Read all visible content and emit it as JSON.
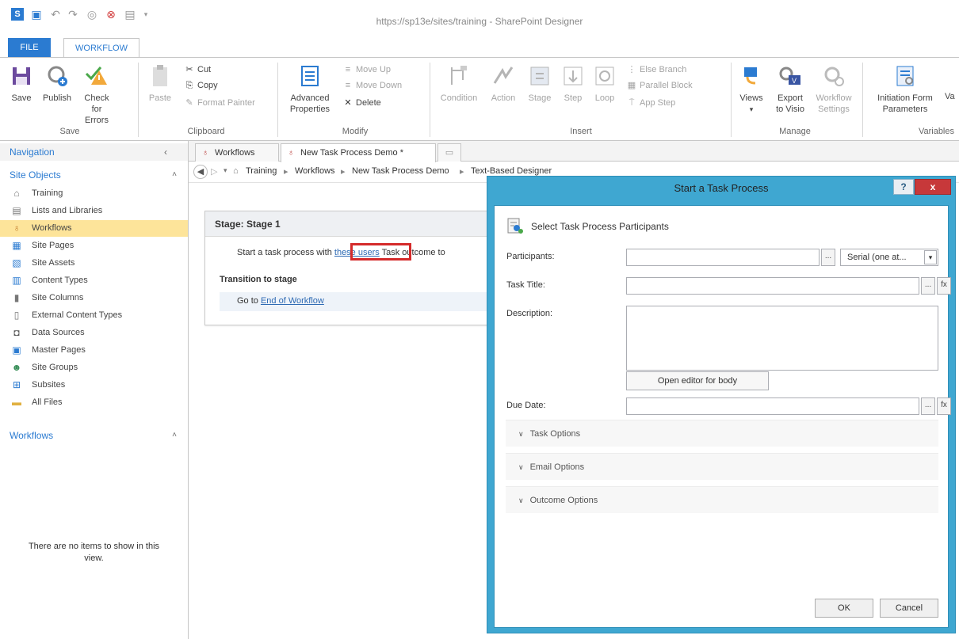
{
  "window": {
    "title": "https://sp13e/sites/training - SharePoint Designer"
  },
  "ribbon_tabs": {
    "file": "FILE",
    "workflow": "WORKFLOW"
  },
  "ribbon": {
    "save": "Save",
    "publish": "Publish",
    "check_errors_1": "Check",
    "check_errors_2": "for Errors",
    "group_save": "Save",
    "paste": "Paste",
    "cut": "Cut",
    "copy": "Copy",
    "format_painter": "Format Painter",
    "group_clipboard": "Clipboard",
    "advanced_properties_1": "Advanced",
    "advanced_properties_2": "Properties",
    "move_up": "Move Up",
    "move_down": "Move Down",
    "delete": "Delete",
    "group_modify": "Modify",
    "condition": "Condition",
    "action": "Action",
    "stage": "Stage",
    "step": "Step",
    "loop": "Loop",
    "else_branch": "Else Branch",
    "parallel_block": "Parallel Block",
    "app_step": "App Step",
    "group_insert": "Insert",
    "views": "Views",
    "export_visio_1": "Export",
    "export_visio_2": "to Visio",
    "workflow_settings_1": "Workflow",
    "workflow_settings_2": "Settings",
    "group_manage": "Manage",
    "initiation_form_1": "Initiation Form",
    "initiation_form_2": "Parameters",
    "local_variables_cut": "Va",
    "group_variables": "Variables"
  },
  "nav": {
    "header": "Navigation",
    "site_objects": "Site Objects",
    "items": [
      {
        "label": "Training",
        "icon": "home-icon"
      },
      {
        "label": "Lists and Libraries",
        "icon": "list-icon"
      },
      {
        "label": "Workflows",
        "icon": "workflow-icon"
      },
      {
        "label": "Site Pages",
        "icon": "page-icon"
      },
      {
        "label": "Site Assets",
        "icon": "assets-icon"
      },
      {
        "label": "Content Types",
        "icon": "content-type-icon"
      },
      {
        "label": "Site Columns",
        "icon": "column-icon"
      },
      {
        "label": "External Content Types",
        "icon": "external-icon"
      },
      {
        "label": "Data Sources",
        "icon": "database-icon"
      },
      {
        "label": "Master Pages",
        "icon": "master-page-icon"
      },
      {
        "label": "Site Groups",
        "icon": "group-icon"
      },
      {
        "label": "Subsites",
        "icon": "subsite-icon"
      },
      {
        "label": "All Files",
        "icon": "folder-icon"
      }
    ],
    "workflows_header": "Workflows",
    "empty_line1": "There are no items to show in this",
    "empty_line2": "view."
  },
  "doc_tabs": {
    "tab1": "Workflows",
    "tab2": "New Task Process Demo *"
  },
  "breadcrumb": {
    "training": "Training",
    "workflows": "Workflows",
    "demo": "New Task Process Demo",
    "designer": "Text-Based Designer"
  },
  "stage": {
    "title": "Stage: Stage 1",
    "text_before": "Start a task process with ",
    "link": "these users",
    "text_after": " Task outcome to",
    "transition": "Transition to stage",
    "goto": "Go to ",
    "end_link": "End of Workflow"
  },
  "dialog": {
    "title": "Start a Task Process",
    "help": "?",
    "close": "x",
    "header": "Select Task Process Participants",
    "participants_label": "Participants:",
    "participants_value": "",
    "order_select": "Serial (one at...",
    "task_title_label": "Task Title:",
    "task_title_value": "",
    "description_label": "Description:",
    "description_value": "",
    "open_editor": "Open editor for body",
    "due_date_label": "Due Date:",
    "due_date_value": "",
    "ellipsis": "...",
    "fx": "fx",
    "task_options": "Task Options",
    "email_options": "Email Options",
    "outcome_options": "Outcome Options",
    "ok": "OK",
    "cancel": "Cancel"
  }
}
